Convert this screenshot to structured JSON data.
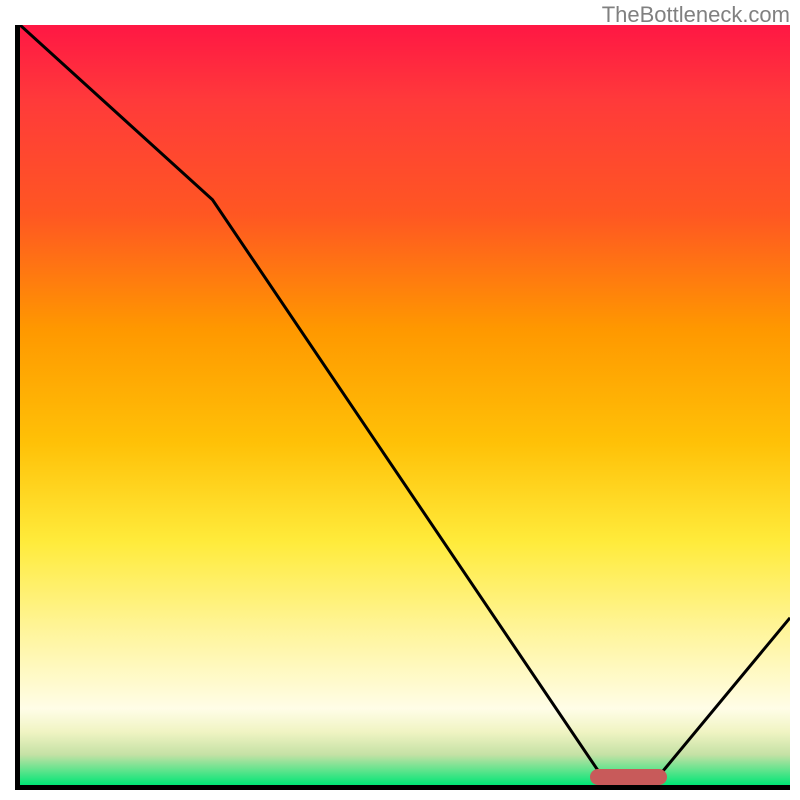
{
  "watermark": "TheBottleneck.com",
  "chart_data": {
    "type": "line",
    "title": "",
    "xlabel": "",
    "ylabel": "",
    "xlim": [
      0,
      100
    ],
    "ylim": [
      0,
      100
    ],
    "x": [
      0,
      25,
      75,
      82,
      100
    ],
    "values": [
      100,
      77,
      2,
      0,
      22
    ],
    "marker": {
      "x_start": 74,
      "x_end": 84,
      "y": 1
    },
    "gradient_colors": {
      "top": "#ff1744",
      "mid_upper": "#ff9800",
      "mid": "#ffeb3b",
      "mid_lower": "#fffde7",
      "bottom": "#00e676"
    }
  }
}
